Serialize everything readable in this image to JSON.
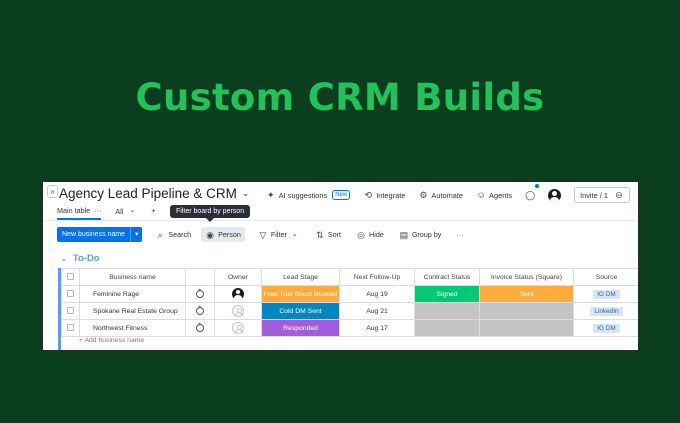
{
  "hero": {
    "title": "Custom CRM Builds"
  },
  "board": {
    "collapse_glyph": "»",
    "title": "Agency Lead Pipeline & CRM",
    "title_chevron": "⌄"
  },
  "top_actions": {
    "ai_suggestions": "AI suggestions",
    "new_badge": "New",
    "integrate": "Integrate",
    "automate": "Automate",
    "agents": "Agents",
    "invite": "Invite / 1"
  },
  "view_tabs": {
    "main_table": "Main table",
    "main_table_more": "···",
    "all": "All",
    "add": "+"
  },
  "tooltip": {
    "text": "Filter board by person"
  },
  "toolbar": {
    "new_item": "New business name",
    "search": "Search",
    "person": "Person",
    "filter": "Filter",
    "sort": "Sort",
    "hide": "Hide",
    "group_by": "Group by",
    "more": "···"
  },
  "group": {
    "title": "To-Do"
  },
  "table": {
    "headers": {
      "name": "Business name",
      "owner": "Owner",
      "lead_stage": "Lead Stage",
      "next_follow_up": "Next Follow-Up",
      "contract_status": "Contract Status",
      "invoice_status": "Invoice Status (Square)",
      "source": "Source"
    },
    "rows": [
      {
        "name": "Feminine Rage",
        "owner": "filled",
        "lead_stage": "Free Trial Shoot Booked",
        "lead_stage_color": "#fdab3d",
        "next_follow_up": "Aug 19",
        "contract_status": "Signed",
        "contract_color": "#00c875",
        "invoice_status": "Sent",
        "invoice_color": "#fdab3d",
        "source": "IG DM"
      },
      {
        "name": "Spokane Real Estate Group",
        "owner": "empty",
        "lead_stage": "Cold DM Sent",
        "lead_stage_color": "#0086c0",
        "next_follow_up": "Aug 21",
        "contract_status": "",
        "contract_color": "#c4c4c4",
        "invoice_status": "",
        "invoice_color": "#c4c4c4",
        "source": "LinkedIn"
      },
      {
        "name": "Northwest Fitness",
        "owner": "empty",
        "lead_stage": "Responded",
        "lead_stage_color": "#a25ddc",
        "next_follow_up": "Aug 17",
        "contract_status": "",
        "contract_color": "#c4c4c4",
        "invoice_status": "",
        "invoice_color": "#c4c4c4",
        "source": "IG DM"
      }
    ],
    "add_item": "+ Add business name"
  }
}
